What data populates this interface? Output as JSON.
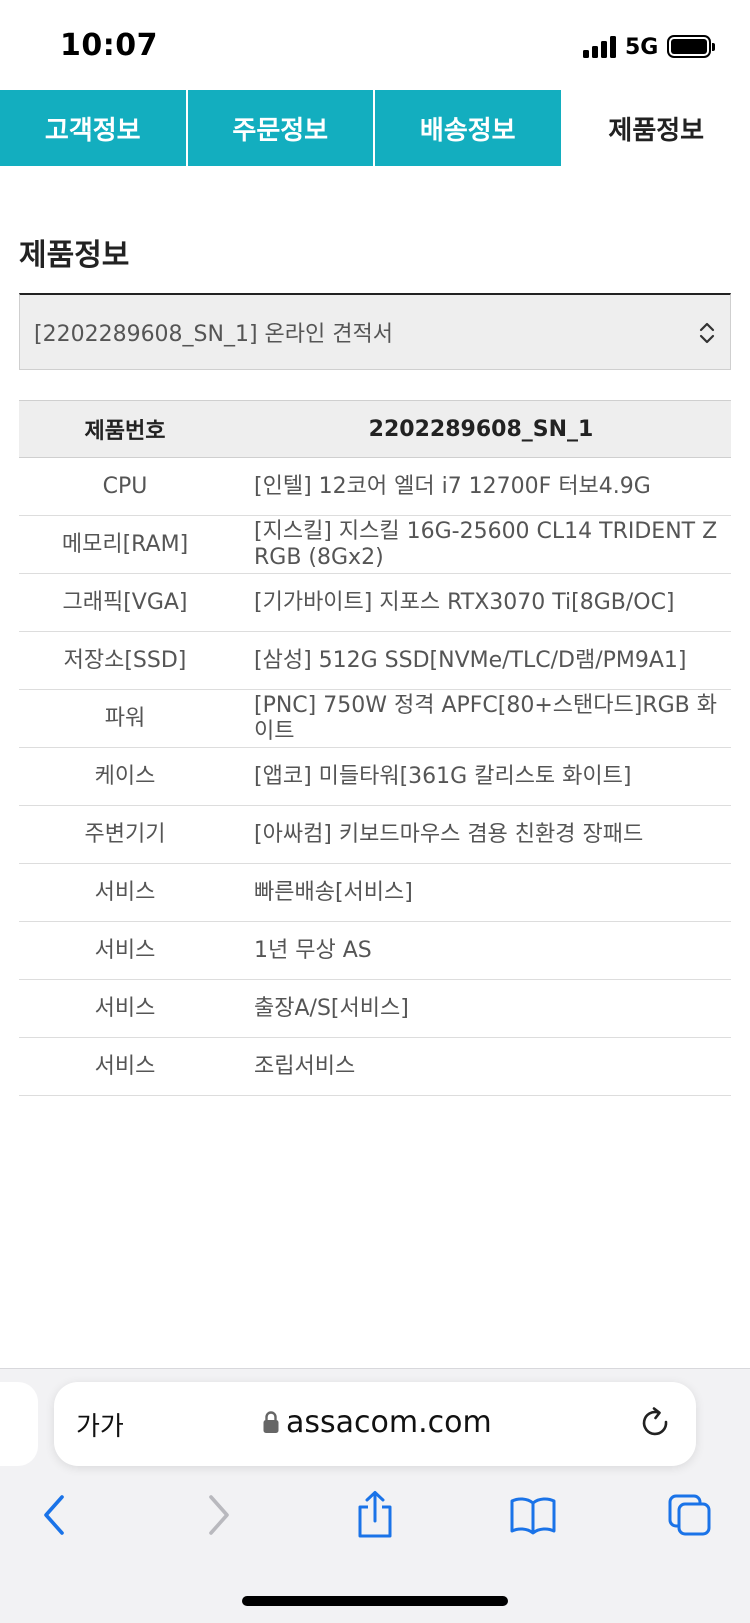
{
  "status_bar": {
    "time": "10:07",
    "network": "5G"
  },
  "tabs": [
    {
      "label": "고객정보",
      "active": false
    },
    {
      "label": "주문정보",
      "active": false
    },
    {
      "label": "배송정보",
      "active": false
    },
    {
      "label": "제품정보",
      "active": true
    }
  ],
  "section": {
    "title": "제품정보"
  },
  "quote_select": {
    "selected": "[2202289608_SN_1] 온라인 견적서"
  },
  "spec_table": {
    "header_label": "제품번호",
    "header_value": "2202289608_SN_1",
    "rows": [
      {
        "label": "CPU",
        "value": "[인텔] 12코어 엘더 i7 12700F 터보4.9G"
      },
      {
        "label": "메모리[RAM]",
        "value": "[지스킬] 지스킬 16G-25600 CL14 TRIDENT Z RGB (8Gx2)"
      },
      {
        "label": "그래픽[VGA]",
        "value": "[기가바이트] 지포스 RTX3070 Ti[8GB/OC]"
      },
      {
        "label": "저장소[SSD]",
        "value": "[삼성] 512G SSD[NVMe/TLC/D램/PM9A1]"
      },
      {
        "label": "파워",
        "value": "[PNC] 750W 정격 APFC[80+스탠다드]RGB 화이트"
      },
      {
        "label": "케이스",
        "value": "[앱코] 미들타워[361G 칼리스토 화이트]"
      },
      {
        "label": "주변기기",
        "value": "[아싸컴] 키보드마우스 겸용 친환경 장패드"
      },
      {
        "label": "서비스",
        "value": "빠른배송[서비스]"
      },
      {
        "label": "서비스",
        "value": "1년 무상 AS"
      },
      {
        "label": "서비스",
        "value": "출장A/S[서비스]"
      },
      {
        "label": "서비스",
        "value": "조립서비스"
      }
    ]
  },
  "browser": {
    "text_size_label": "가가",
    "url": "assacom.com"
  },
  "colors": {
    "tab_background": "#13aebf",
    "tab_active_background": "#ffffff",
    "link_blue": "#1a73e8"
  },
  "icons": {
    "lock": "lock-icon",
    "reload": "reload-icon",
    "back": "chevron-left-icon",
    "forward": "chevron-right-icon",
    "share": "share-icon",
    "bookmarks": "book-icon",
    "tabs": "tabs-icon"
  }
}
